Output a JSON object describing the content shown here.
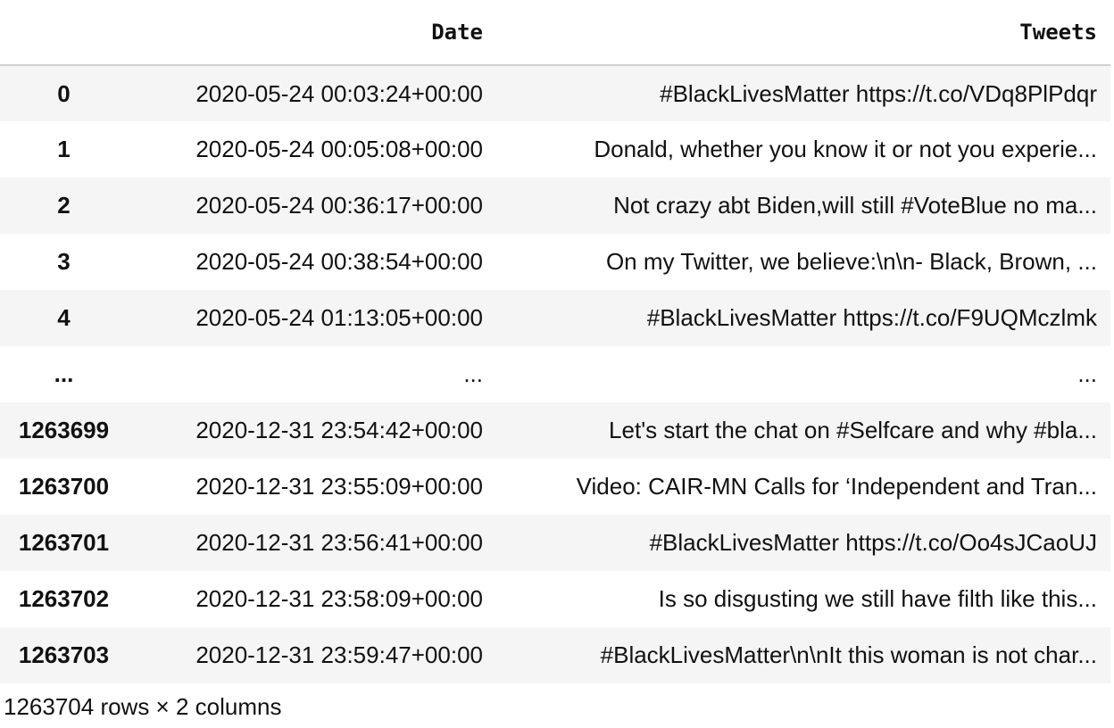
{
  "table": {
    "headers": [
      "",
      "Date",
      "Tweets"
    ],
    "rows": [
      {
        "index": "0",
        "date": "2020-05-24 00:03:24+00:00",
        "tweet": "#BlackLivesMatter https://t.co/VDq8PlPdqr"
      },
      {
        "index": "1",
        "date": "2020-05-24 00:05:08+00:00",
        "tweet": "Donald, whether you know it or not you experie..."
      },
      {
        "index": "2",
        "date": "2020-05-24 00:36:17+00:00",
        "tweet": "Not crazy abt Biden,will still #VoteBlue no ma..."
      },
      {
        "index": "3",
        "date": "2020-05-24 00:38:54+00:00",
        "tweet": "On my Twitter, we believe:\\n\\n- Black, Brown, ..."
      },
      {
        "index": "4",
        "date": "2020-05-24 01:13:05+00:00",
        "tweet": "#BlackLivesMatter https://t.co/F9UQMczlmk"
      },
      {
        "index": "...",
        "date": "...",
        "tweet": "..."
      },
      {
        "index": "1263699",
        "date": "2020-12-31 23:54:42+00:00",
        "tweet": "Let's start the chat on #Selfcare and why #bla..."
      },
      {
        "index": "1263700",
        "date": "2020-12-31 23:55:09+00:00",
        "tweet": "Video: CAIR-MN Calls for ‘Independent and Tran..."
      },
      {
        "index": "1263701",
        "date": "2020-12-31 23:56:41+00:00",
        "tweet": "#BlackLivesMatter https://t.co/Oo4sJCaoUJ"
      },
      {
        "index": "1263702",
        "date": "2020-12-31 23:58:09+00:00",
        "tweet": "Is so disgusting we still have filth like this..."
      },
      {
        "index": "1263703",
        "date": "2020-12-31 23:59:47+00:00",
        "tweet": "#BlackLivesMatter\\n\\nIt this woman is not char..."
      }
    ]
  },
  "footer": {
    "shape_text": "1263704 rows × 2 columns"
  },
  "colors": {
    "striped_row": "#f5f5f5",
    "header_rule": "#d0d0d0",
    "text": "#111111"
  }
}
